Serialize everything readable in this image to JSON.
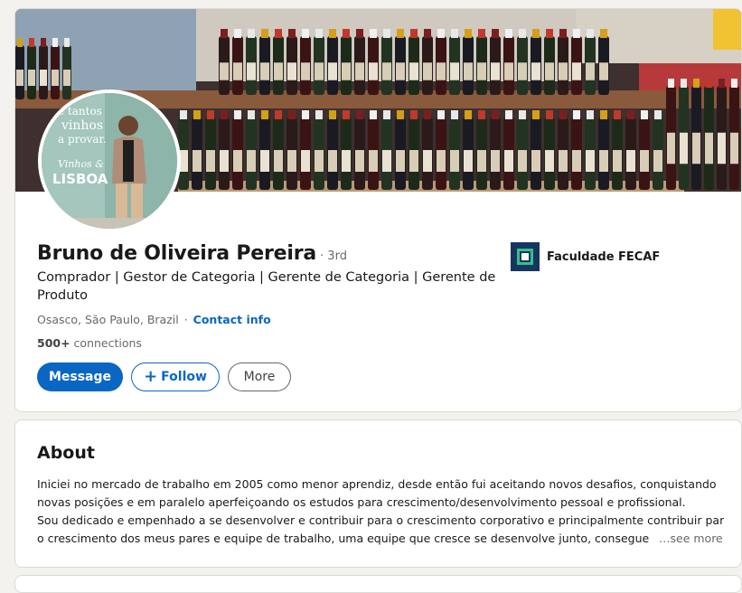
{
  "profile": {
    "name": "Bruno de Oliveira Pereira",
    "degree": "· 3rd",
    "headline": "Comprador | Gestor de Categoria | Gerente de Categoria | Gerente de Produto",
    "location": "Osasco, São Paulo, Brazil",
    "separator": "·",
    "contact_info": "Contact info",
    "connections_count": "500+",
    "connections_label": " connections",
    "avatar_sign": {
      "line1": "e tantos",
      "line2": "vinhos",
      "line3": "a provar.",
      "line4": "Vinhos &",
      "line5": "LISBOA"
    }
  },
  "actions": {
    "message": "Message",
    "follow": "Follow",
    "more": "More"
  },
  "education": {
    "name": "Faculdade FECAF"
  },
  "about": {
    "title": "About",
    "lines": [
      "Iniciei no mercado de trabalho em 2005 como menor aprendiz, desde então fui aceitando novos desafios, conquistando",
      "novas posições e em paralelo aperfeiçoando os estudos para crescimento/desenvolvimento pessoal e profissional.",
      "Sou dedicado e empenhado a se desenvolver e contribuir para o crescimento corporativo e principalmente contribuir para",
      "o crescimento dos meus pares e equipe de trabalho, uma equipe que cresce se desenvolve junto, consegue ati"
    ],
    "see_more": "…see more"
  },
  "colors": {
    "brand_blue": "#0a66c2",
    "fecaf_navy": "#15365f",
    "fecaf_green": "#33c08a"
  }
}
